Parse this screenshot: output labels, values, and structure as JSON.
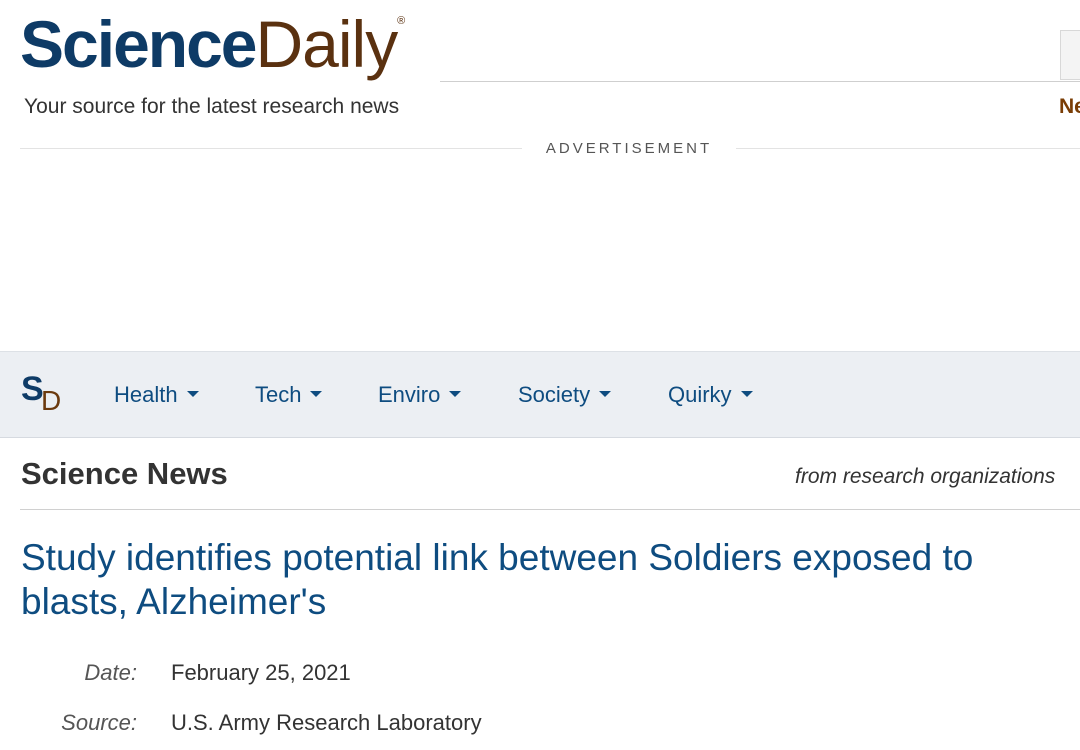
{
  "header": {
    "logo_primary": "Science",
    "logo_secondary": "Daily",
    "logo_registered": "®",
    "tagline": "Your source for the latest research news",
    "right_link_partial": "Ne"
  },
  "ad": {
    "label": "ADVERTISEMENT"
  },
  "nav": {
    "logo_s": "S",
    "logo_d": "D",
    "items": [
      {
        "label": "Health"
      },
      {
        "label": "Tech"
      },
      {
        "label": "Enviro"
      },
      {
        "label": "Society"
      },
      {
        "label": "Quirky"
      }
    ]
  },
  "section": {
    "title": "Science News",
    "subtitle": "from research organizations"
  },
  "article": {
    "headline": "Study identifies potential link between Soldiers exposed to blasts, Alzheimer's",
    "date_label": "Date:",
    "date_value": "February 25, 2021",
    "source_label": "Source:",
    "source_value": "U.S. Army Research Laboratory"
  },
  "colors": {
    "brand_blue": "#0e3b66",
    "brand_brown": "#5a3110",
    "link_blue": "#0e4c80",
    "nav_bg": "#eceff3"
  }
}
